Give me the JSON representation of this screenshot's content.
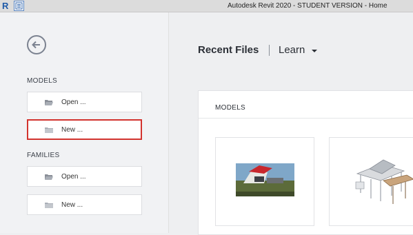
{
  "titlebar": {
    "app_logo": "R",
    "title": "Autodesk Revit 2020 - STUDENT VERSION - Home"
  },
  "sidebar": {
    "models_label": "MODELS",
    "models_open_label": "Open ...",
    "models_new_label": "New ...",
    "families_label": "FAMILIES",
    "families_open_label": "Open ...",
    "families_new_label": "New ..."
  },
  "main": {
    "tab_recent": "Recent Files",
    "tab_learn": "Learn",
    "panel_title": "MODELS"
  },
  "colors": {
    "highlight_border": "#d2322d",
    "accent_blue": "#1e5aa8"
  }
}
